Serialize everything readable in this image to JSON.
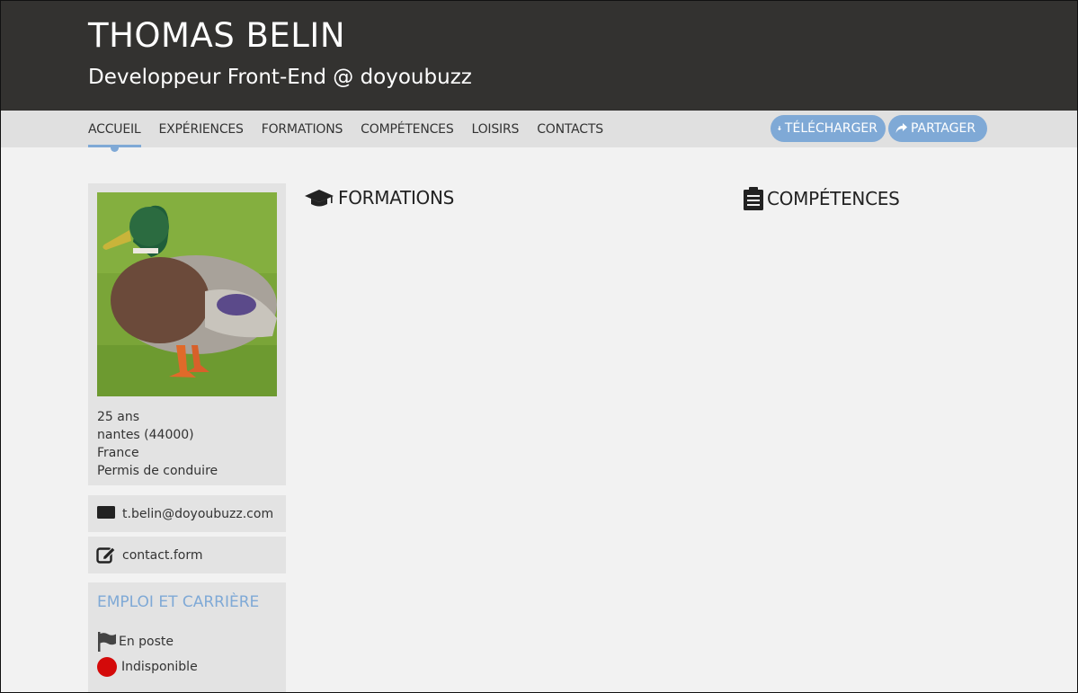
{
  "header": {
    "name": "THOMAS BELIN",
    "subtitle": "Developpeur Front-End @ doyoubuzz"
  },
  "nav": {
    "items": [
      "ACCUEIL",
      "EXPÉRIENCES",
      "FORMATIONS",
      "COMPÉTENCES",
      "LOISIRS",
      "CONTACTS"
    ],
    "active_index": 0,
    "download_label": "TÉLÉCHARGER",
    "share_label": "PARTAGER"
  },
  "profile": {
    "age": "25 ans",
    "city": "nantes (44000)",
    "country": "France",
    "license": "Permis de conduire"
  },
  "contact": {
    "email": "t.belin@doyoubuzz.com",
    "form": "contact.form"
  },
  "career": {
    "title": "EMPLOI ET CARRIÈRE",
    "status": "En poste",
    "availability": "Indisponible"
  },
  "sections": {
    "formations": "FORMATIONS",
    "competences": "COMPÉTENCES"
  },
  "icons": {
    "download": "download-icon",
    "share": "share-icon",
    "email": "envelope-icon",
    "form": "edit-icon",
    "status": "flag-icon",
    "availability": "red-dot-icon",
    "formations": "graduation-cap-icon",
    "competences": "clipboard-icon"
  },
  "colors": {
    "header_bg": "#333230",
    "nav_bg": "#e0e0e0",
    "accent": "#7fa9d6",
    "unavailable": "#d40a0a"
  }
}
